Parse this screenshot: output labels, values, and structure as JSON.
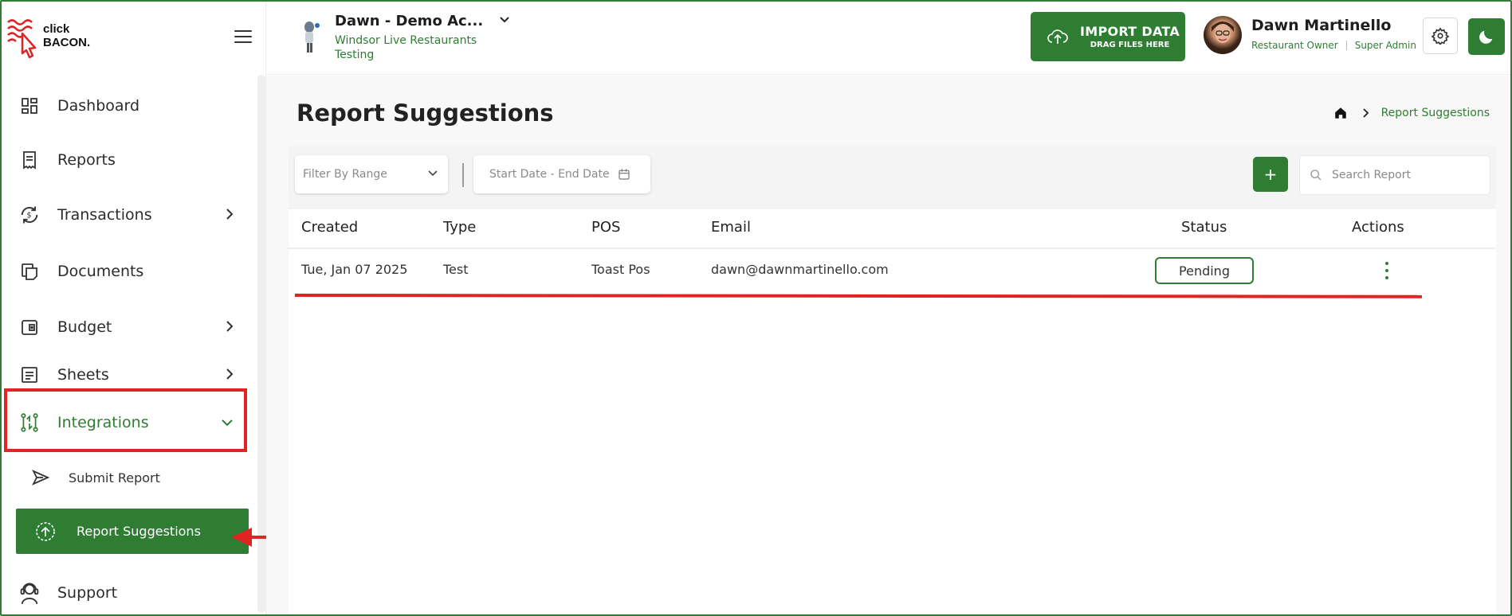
{
  "brand": {
    "line1": "click",
    "line2": "BACON."
  },
  "sidebar": {
    "items": [
      {
        "label": "Dashboard",
        "icon": "dashboard-icon"
      },
      {
        "label": "Reports",
        "icon": "reports-icon"
      },
      {
        "label": "Transactions",
        "icon": "transactions-icon"
      },
      {
        "label": "Documents",
        "icon": "documents-icon"
      },
      {
        "label": "Budget",
        "icon": "budget-icon"
      },
      {
        "label": "Sheets",
        "icon": "sheets-icon"
      },
      {
        "label": "Integrations",
        "icon": "integrations-icon"
      },
      {
        "label": "Support",
        "icon": "support-icon"
      }
    ],
    "sub_items": [
      {
        "label": "Submit Report",
        "icon": "send-icon"
      },
      {
        "label": "Report Suggestions",
        "icon": "upload-circle-icon"
      }
    ]
  },
  "header": {
    "account_name": "Dawn - Demo Ac...",
    "account_sub": "Windsor Live Restaurants Testing",
    "import_label": "IMPORT DATA",
    "import_sub": "DRAG FILES HERE",
    "user_name": "Dawn Martinello",
    "user_role": "Restaurant Owner",
    "user_level": "Super Admin"
  },
  "page": {
    "title": "Report Suggestions",
    "breadcrumb_current": "Report Suggestions"
  },
  "toolbar": {
    "filter_placeholder": "Filter By Range",
    "date_placeholder": "Start Date - End Date",
    "add_label": "+",
    "search_placeholder": "Search Report"
  },
  "table": {
    "headers": [
      "Created",
      "Type",
      "POS",
      "Email",
      "Status",
      "Actions"
    ],
    "rows": [
      {
        "created": "Tue, Jan 07 2025",
        "type": "Test",
        "pos": "Toast Pos",
        "email": "dawn@dawnmartinello.com",
        "status": "Pending"
      }
    ]
  },
  "colors": {
    "accent": "#2e7d32",
    "annotation": "#e02424"
  }
}
